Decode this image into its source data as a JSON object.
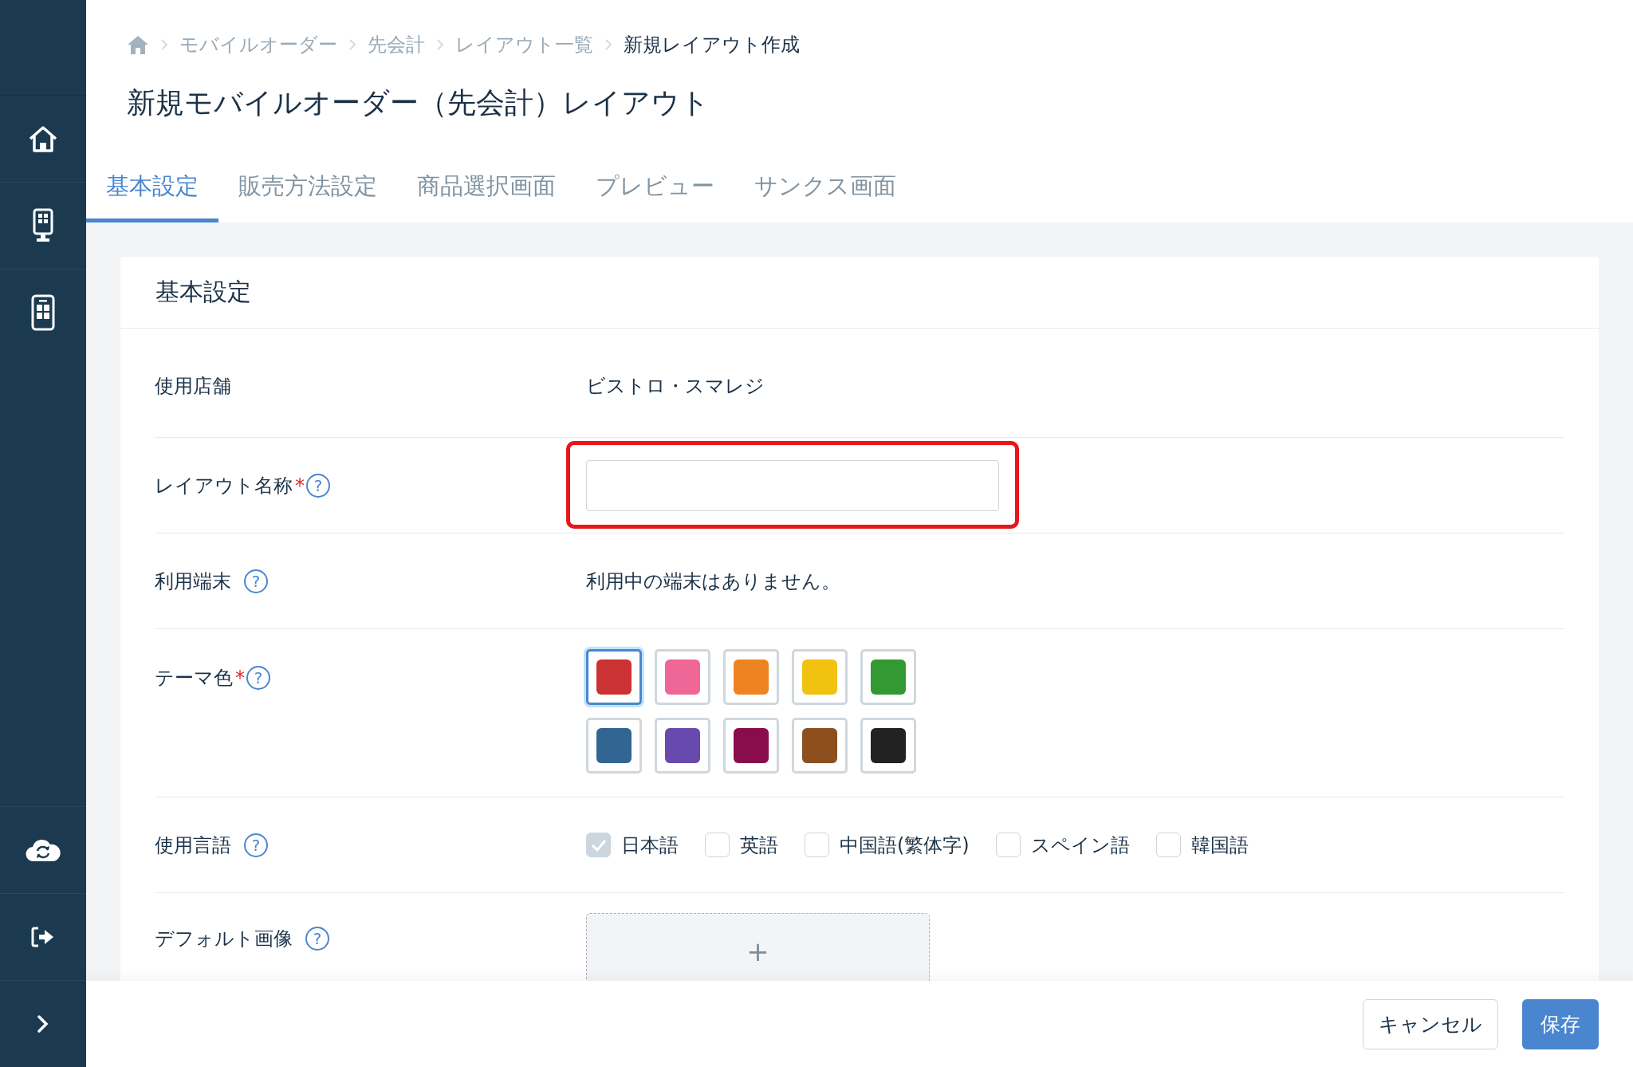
{
  "breadcrumbs": [
    {
      "label": "モバイルオーダー",
      "current": false
    },
    {
      "label": "先会計",
      "current": false
    },
    {
      "label": "レイアウト一覧",
      "current": false
    },
    {
      "label": "新規レイアウト作成",
      "current": true
    }
  ],
  "page_title": "新規モバイルオーダー（先会計）レイアウト",
  "tabs": [
    {
      "label": "基本設定",
      "selected": true
    },
    {
      "label": "販売方法設定",
      "selected": false
    },
    {
      "label": "商品選択画面",
      "selected": false
    },
    {
      "label": "プレビュー",
      "selected": false
    },
    {
      "label": "サンクス画面",
      "selected": false
    }
  ],
  "card": {
    "title": "基本設定",
    "rows": [
      {
        "kind": "text",
        "label": "使用店舗",
        "value": "ビストロ・スマレジ"
      },
      {
        "kind": "input",
        "label": "レイアウト名称",
        "required_mark": "*",
        "help_icon": "?",
        "highlighted": true
      },
      {
        "kind": "text",
        "label": "利用端末",
        "help_icon": "?",
        "value": "利用中の端末はありません。"
      },
      {
        "kind": "colors",
        "label": "テーマ色",
        "required_mark": "*",
        "help_icon": "?",
        "colors": [
          {
            "color": "#cb3234",
            "selected": true
          },
          {
            "color": "#ee6796",
            "selected": false
          },
          {
            "color": "#ee8322",
            "selected": false
          },
          {
            "color": "#f1c20f",
            "selected": false
          },
          {
            "color": "#339933",
            "selected": false
          },
          {
            "color": "#336593",
            "selected": false
          },
          {
            "color": "#6849ae",
            "selected": false
          },
          {
            "color": "#890c4c",
            "selected": false
          },
          {
            "color": "#8c4f1d",
            "selected": false
          },
          {
            "color": "#222222",
            "selected": false
          }
        ]
      },
      {
        "kind": "languages",
        "label": "使用言語",
        "help_icon": "?",
        "options": [
          {
            "label": "日本語",
            "checked": true
          },
          {
            "label": "英語",
            "checked": false
          },
          {
            "label": "中国語(繁体字)",
            "checked": false
          },
          {
            "label": "スペイン語",
            "checked": false
          },
          {
            "label": "韓国語",
            "checked": false
          }
        ]
      },
      {
        "kind": "image",
        "label": "デフォルト画像",
        "help_icon": "?",
        "add_icon": "+"
      }
    ]
  },
  "footer": {
    "buttons": [
      {
        "label": "キャンセル",
        "kind": "secondary"
      },
      {
        "label": "保存",
        "kind": "primary"
      }
    ]
  }
}
